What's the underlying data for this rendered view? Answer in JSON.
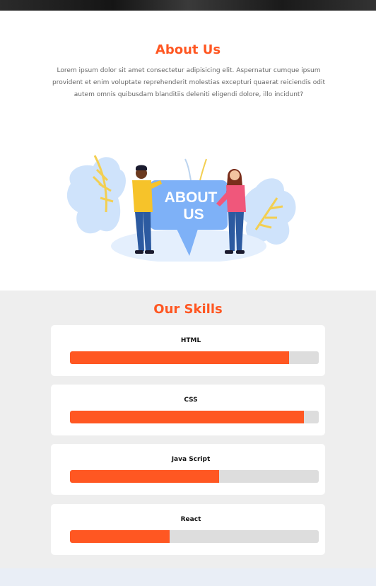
{
  "about": {
    "title": "About Us",
    "text": "Lorem ipsum dolor sit amet consectetur adipisicing elit. Aspernatur cumque ipsum provident et enim voluptate reprehenderit molestias excepturi quaerat reiciendis odit autem omnis quibusdam blanditiis deleniti eligendi dolore, illo incidunt?",
    "banner_line1": "ABOUT",
    "banner_line2": "US"
  },
  "skills": {
    "title": "Our Skills",
    "items": [
      {
        "label": "HTML",
        "percent": 88
      },
      {
        "label": "CSS",
        "percent": 94
      },
      {
        "label": "Java Script",
        "percent": 60
      },
      {
        "label": "React",
        "percent": 40
      }
    ]
  },
  "colors": {
    "accent": "#ff5722",
    "track": "#dddddd",
    "section_bg": "#eeeeee"
  },
  "icons": {
    "settings": "gear-icon"
  }
}
